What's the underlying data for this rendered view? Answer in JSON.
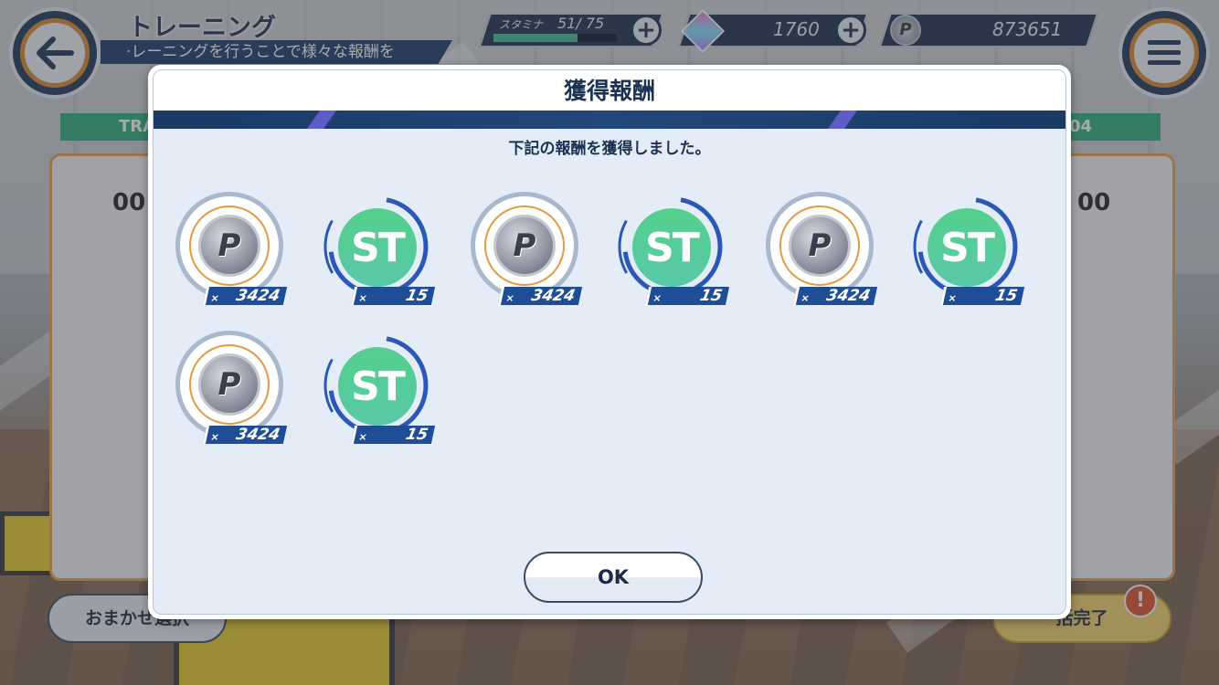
{
  "header": {
    "title": "トレーニング",
    "subtitle": "·レーニングを行うことで様々な報酬を",
    "stamina_label": "スタミナ",
    "stamina_value": "51/ 75",
    "stamina_fraction": 0.68,
    "gems": "1760",
    "coins": "873651"
  },
  "background": {
    "left_tab": "TRA",
    "right_tab": "04",
    "left_counter": "00",
    "right_counter": "00",
    "left_bottom_button": "おまかせ選択",
    "right_bottom_button": "括完了",
    "alert_badge": "!"
  },
  "modal": {
    "title": "獲得報酬",
    "message": "下記の報酬を獲得しました。",
    "ok_label": "OK",
    "rewards": [
      {
        "icon": "p-coin-icon",
        "glyph": "P",
        "quantity_prefix": "×",
        "quantity": "3424"
      },
      {
        "icon": "st-icon",
        "glyph": "ST",
        "quantity_prefix": "×",
        "quantity": "15"
      },
      {
        "icon": "p-coin-icon",
        "glyph": "P",
        "quantity_prefix": "×",
        "quantity": "3424"
      },
      {
        "icon": "st-icon",
        "glyph": "ST",
        "quantity_prefix": "×",
        "quantity": "15"
      },
      {
        "icon": "p-coin-icon",
        "glyph": "P",
        "quantity_prefix": "×",
        "quantity": "3424"
      },
      {
        "icon": "st-icon",
        "glyph": "ST",
        "quantity_prefix": "×",
        "quantity": "15"
      },
      {
        "icon": "p-coin-icon",
        "glyph": "P",
        "quantity_prefix": "×",
        "quantity": "3424"
      },
      {
        "icon": "st-icon",
        "glyph": "ST",
        "quantity_prefix": "×",
        "quantity": "15"
      }
    ]
  },
  "colors": {
    "navy": "#1c3253",
    "accent_orange": "#d6892e",
    "stamina_green": "#3bbf8a",
    "quantity_blue": "#1f4d96"
  }
}
